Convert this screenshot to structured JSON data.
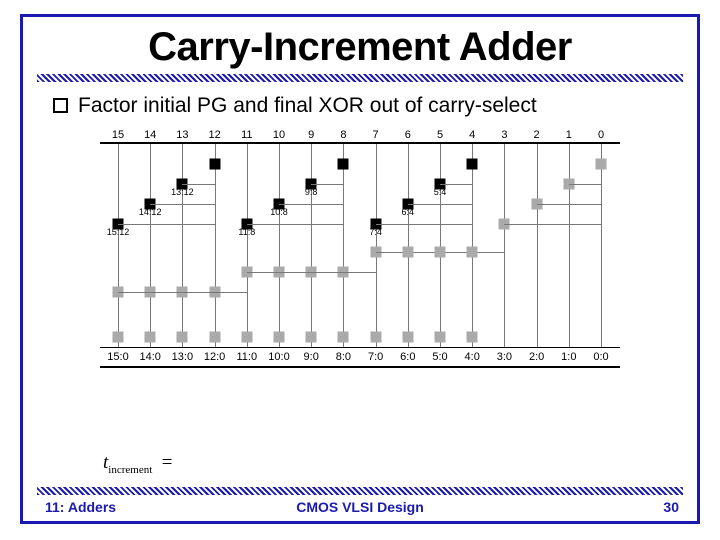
{
  "title": "Carry-Increment Adder",
  "bullet": "Factor initial PG and final XOR out of carry-select",
  "top_labels": [
    "15",
    "14",
    "13",
    "12",
    "11",
    "10",
    "9",
    "8",
    "7",
    "6",
    "5",
    "4",
    "3",
    "2",
    "1",
    "0"
  ],
  "bottom_labels": [
    "15:0",
    "14:0",
    "13:0",
    "12:0",
    "11:0",
    "10:0",
    "9:0",
    "8:0",
    "7:0",
    "6:0",
    "5:0",
    "4:0",
    "3:0",
    "2:0",
    "1:0",
    "0:0"
  ],
  "node_labels": {
    "a": "13:12",
    "b": "14:12",
    "c": "15:12",
    "d": "9:8",
    "e": "10:8",
    "f": "11:8",
    "g": "5:4",
    "h": "6:4",
    "i": "7:4"
  },
  "formula_var": "t",
  "formula_sub": "increment",
  "formula_eq": "=",
  "footer": {
    "left": "11: Adders",
    "center": "CMOS VLSI Design",
    "right": "30"
  }
}
